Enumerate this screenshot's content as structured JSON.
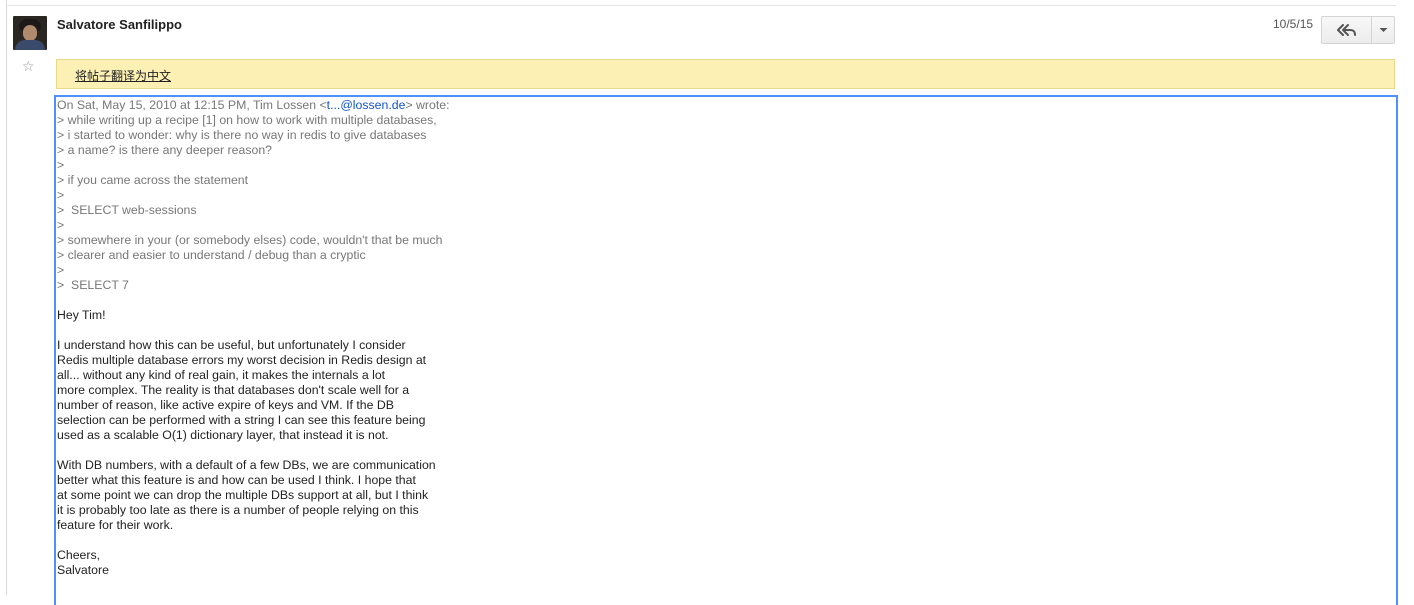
{
  "message": {
    "sender_name": "Salvatore Sanfilippo",
    "date": "10/5/15",
    "translate_label": "将帖子翻译为中文",
    "icons": {
      "avatar": "avatar-photo",
      "star": "star-icon",
      "reply": "reply-all-icon",
      "more": "chevron-down-icon"
    },
    "accent_color": "#4d90fe",
    "translate_bg": "#fcf0b4"
  },
  "attribution": {
    "prefix": "On Sat, May 15, 2010 at 12:15 PM, Tim Lossen <",
    "email": "t...@lossen.de",
    "suffix": "> wrote:"
  },
  "quote_lines": [
    "> while writing up a recipe [1] on how to work with multiple databases,",
    "> i started to wonder: why is there no way in redis to give databases",
    "> a name? is there any deeper reason?",
    ">",
    "> if you came across the statement",
    ">",
    ">  SELECT web-sessions",
    ">",
    "> somewhere in your (or somebody elses) code, wouldn't that be much",
    "> clearer and easier to understand / debug than a cryptic",
    ">",
    ">  SELECT 7"
  ],
  "reply_lines": [
    "Hey Tim!",
    "",
    "I understand how this can be useful, but unfortunately I consider",
    "Redis multiple database errors my worst decision in Redis design at",
    "all... without any kind of real gain, it makes the internals a lot",
    "more complex. The reality is that databases don't scale well for a",
    "number of reason, like active expire of keys and VM. If the DB",
    "selection can be performed with a string I can see this feature being",
    "used as a scalable O(1) dictionary layer, that instead it is not.",
    "",
    "With DB numbers, with a default of a few DBs, we are communication",
    "better what this feature is and how can be used I think. I hope that",
    "at some point we can drop the multiple DBs support at all, but I think",
    "it is probably too late as there is a number of people relying on this",
    "feature for their work.",
    "",
    "Cheers,",
    "Salvatore"
  ]
}
